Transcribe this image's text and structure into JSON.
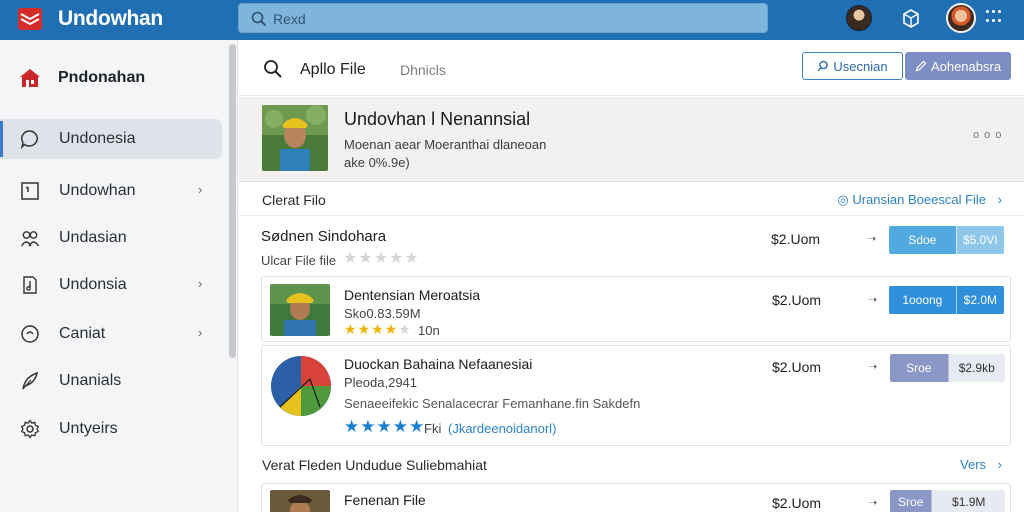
{
  "app": {
    "brand": "Undowhan"
  },
  "search": {
    "placeholder": "Rexd"
  },
  "sidebar": {
    "header": "Pndonahan",
    "items": [
      {
        "label": "Undonesia",
        "icon": "chat-icon",
        "chevron": ""
      },
      {
        "label": "Undowhan",
        "icon": "calendar-icon",
        "chevron": "›"
      },
      {
        "label": "Undasian",
        "icon": "people-icon",
        "chevron": ""
      },
      {
        "label": "Undonsia",
        "icon": "document-icon",
        "chevron": "›"
      },
      {
        "label": "Caniat",
        "icon": "clock-icon",
        "chevron": "›"
      },
      {
        "label": "Unanials",
        "icon": "feather-icon",
        "chevron": ""
      },
      {
        "label": "Untyeirs",
        "icon": "gear-icon",
        "chevron": ""
      }
    ]
  },
  "main": {
    "title": "Apllo File",
    "subtitle": "Dhnicls",
    "btn_outline": "Usecnian",
    "btn_fill": "Aohenabsra"
  },
  "featured": {
    "title": "Undovhan l Nenannsial",
    "line2": "Moenan aear Moeranthai dlaneoan",
    "line3": "ake 0%.9e)",
    "dots": "o o o"
  },
  "section1": {
    "title": "Clerat Filo",
    "link": "Uransian Boeescal File",
    "link_arrow": "›"
  },
  "section2": {
    "title": "Verat Fleden Undudue Suliebmahiat",
    "link": "Vers",
    "link_arrow": "›"
  },
  "rows": [
    {
      "title": "Sødnen Sindohara",
      "sub": "Ulcar File file",
      "rating": 0,
      "rating_text": "",
      "extra": "",
      "price": "$2.Uom",
      "arrow": "➝",
      "pill_a": "Sdoe",
      "pill_b": "$5.0VI",
      "pill_color": "#52a9e0"
    },
    {
      "title": "Dentensian Meroatsia",
      "sub": "Sko0.83.59M",
      "rating": 4,
      "rating_text": "10n",
      "extra": "",
      "price": "$2.Uom",
      "arrow": "➝",
      "pill_a": "1ooong",
      "pill_b": "$2.0M",
      "pill_color": "#2f8fdb"
    },
    {
      "title": "Duockan Bahaina Nefaanesiai",
      "sub": "Pleoda,2941",
      "rating": 5,
      "rating_text": "Fki",
      "extra": "Senaeeifekic Senalacecrar Femanhane.fin Sakdefn",
      "link": "(Jkardeenoidanorl)",
      "price": "$2.Uom",
      "arrow": "➝",
      "pill_a": "Sroe",
      "pill_b": "$2.9kb",
      "pill_color": "#8b97c6"
    },
    {
      "title": "Fenenan File",
      "sub": "",
      "rating": 0,
      "rating_text": "",
      "extra": "",
      "price": "$2.Uom",
      "arrow": "➝",
      "pill_a": "Sroe",
      "pill_b": "$1.9M",
      "pill_color": "#8b97c6"
    }
  ]
}
